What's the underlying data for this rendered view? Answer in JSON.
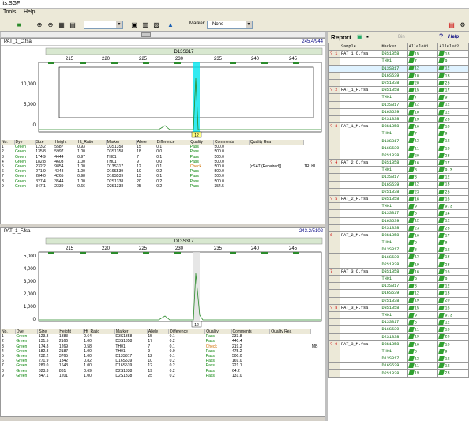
{
  "window": {
    "title": "its.SGF"
  },
  "menu": [
    "Tools",
    "Help"
  ],
  "toolbar": {
    "marker_label": "Marker:",
    "marker_value": "--None--"
  },
  "panel1": {
    "file": "PAT_1_C.fsa",
    "range": "245.4/944",
    "marker": "D13S317",
    "ticks": [
      "215",
      "220",
      "225",
      "230",
      "235",
      "240",
      "245"
    ],
    "yticks": [
      "10,000",
      "5,000",
      "0"
    ],
    "peak_label": "12"
  },
  "panel2": {
    "file": "PAT_1_F.fsa",
    "range": "243.2/5102",
    "marker": "D13S317",
    "ticks": [
      "215",
      "220",
      "225",
      "230",
      "235",
      "240",
      "245"
    ],
    "yticks": [
      "5,000",
      "4,000",
      "3,000",
      "2,000",
      "1,000",
      "0"
    ],
    "peak_label": "12"
  },
  "table_headers": [
    "No.",
    "Dye",
    "Size",
    "Height",
    "Ht_Ratio",
    "Marker",
    "Allele",
    "Difference",
    "Quality",
    "Comments",
    "Quality Rea"
  ],
  "table1": [
    [
      "1",
      "Green",
      "123.2",
      "5587",
      "0.93",
      "D3S1358",
      "15",
      "0.1",
      "Pass",
      "500.0",
      "",
      ""
    ],
    [
      "2",
      "Green",
      "135.8",
      "5997",
      "1.00",
      "D3S1358",
      "18",
      "0.0",
      "Pass",
      "500.0",
      "",
      ""
    ],
    [
      "3",
      "Green",
      "174.9",
      "4444",
      "0.97",
      "TH01",
      "7",
      "0.1",
      "Pass",
      "500.0",
      "",
      ""
    ],
    [
      "4",
      "Green",
      "182.8",
      "4603",
      "1.00",
      "TH01",
      "9",
      "0.0",
      "Pass",
      "500.0",
      "",
      ""
    ],
    [
      "5",
      "Green",
      "232.2",
      "9854",
      "1.00",
      "D13S317",
      "12",
      "0.1",
      "Check",
      "500.0",
      "[cSAT (Repaired)]",
      "1R, HI"
    ],
    [
      "6",
      "Green",
      "271.9",
      "4348",
      "1.00",
      "D16S539",
      "10",
      "0.2",
      "Pass",
      "500.0",
      "",
      ""
    ],
    [
      "7",
      "Green",
      "284.0",
      "4265",
      "0.98",
      "D16S539",
      "13",
      "0.1",
      "Pass",
      "500.0",
      "",
      ""
    ],
    [
      "8",
      "Green",
      "327.4",
      "3544",
      "1.00",
      "D2S1338",
      "20",
      "0.2",
      "Pass",
      "500.0",
      "",
      ""
    ],
    [
      "9",
      "Green",
      "347.1",
      "2339",
      "0.66",
      "D2S1338",
      "25",
      "0.2",
      "Pass",
      "354.5",
      "",
      ""
    ]
  ],
  "table2": [
    [
      "1",
      "Green",
      "123.3",
      "1383",
      "0.64",
      "D3S1358",
      "15",
      "0.1",
      "Pass",
      "233.8",
      "",
      ""
    ],
    [
      "2",
      "Green",
      "131.5",
      "2166",
      "1.00",
      "D3S1358",
      "17",
      "0.2",
      "Pass",
      "440.4",
      "",
      ""
    ],
    [
      "3",
      "Green",
      "174.8",
      "1269",
      "0.58",
      "TH01",
      "7",
      "0.1",
      "Check",
      "219.2",
      "",
      "MB"
    ],
    [
      "4",
      "Green",
      "182.8",
      "2187",
      "1.00",
      "TH01",
      "9",
      "0.0",
      "Pass",
      "475.2",
      "",
      ""
    ],
    [
      "5",
      "Green",
      "232.2",
      "3765",
      "1.00",
      "D13S317",
      "12",
      "0.1",
      "Pass",
      "500.0",
      "",
      ""
    ],
    [
      "6",
      "Green",
      "271.9",
      "1342",
      "0.82",
      "D16S539",
      "10",
      "0.2",
      "Pass",
      "169.0",
      "",
      ""
    ],
    [
      "7",
      "Green",
      "280.0",
      "1643",
      "1.00",
      "D16S539",
      "12",
      "0.2",
      "Pass",
      "221.1",
      "",
      ""
    ],
    [
      "8",
      "Green",
      "323.3",
      "831",
      "0.69",
      "D2S1338",
      "19",
      "0.2",
      "Pass",
      "64.2",
      "",
      ""
    ],
    [
      "9",
      "Green",
      "347.1",
      "1201",
      "1.00",
      "D2S1338",
      "25",
      "0.2",
      "Pass",
      "131.0",
      "",
      ""
    ]
  ],
  "report": {
    "title": "Report",
    "bin_label": "Bin",
    "help_label": "Help",
    "headers": [
      "Sample",
      "Marker",
      "Allele#1",
      "Allele#2"
    ],
    "rows": [
      [
        "? 1",
        "PAT_1_C.fsa",
        "D3S1358",
        "15",
        "18"
      ],
      [
        "",
        "",
        "TH01",
        "7",
        "9"
      ],
      [
        "",
        "",
        "D13S317",
        "12",
        "12"
      ],
      [
        "",
        "",
        "D16S539",
        "10",
        "13"
      ],
      [
        "",
        "",
        "D2S1338",
        "20",
        "25"
      ],
      [
        "? 2",
        "PAT_1_F.fsa",
        "D3S1358",
        "15",
        "17"
      ],
      [
        "",
        "",
        "TH01",
        "7",
        "9"
      ],
      [
        "",
        "",
        "D13S317",
        "12",
        "12"
      ],
      [
        "",
        "",
        "D16S539",
        "10",
        "12"
      ],
      [
        "",
        "",
        "D2S1338",
        "19",
        "25"
      ],
      [
        "? 3",
        "PAT_1_M.fsa",
        "D3S1358",
        "16",
        "18"
      ],
      [
        "",
        "",
        "TH01",
        "7",
        "9"
      ],
      [
        "",
        "",
        "D13S317",
        "12",
        "12"
      ],
      [
        "",
        "",
        "D16S539",
        "11",
        "13"
      ],
      [
        "",
        "",
        "D2S1338",
        "20",
        "23"
      ],
      [
        "? 4",
        "PAT_2_C.fsa",
        "D3S1358",
        "16",
        "17"
      ],
      [
        "",
        "",
        "TH01",
        "8",
        "9.3"
      ],
      [
        "",
        "",
        "D13S317",
        "8",
        "12"
      ],
      [
        "",
        "",
        "D16S539",
        "12",
        "13"
      ],
      [
        "",
        "",
        "D2S1338",
        "23",
        "25"
      ],
      [
        "? 5",
        "PAT_2_F.fsa",
        "D3S1358",
        "16",
        "16"
      ],
      [
        "",
        "",
        "TH01",
        "9",
        "9.3"
      ],
      [
        "",
        "",
        "D13S317",
        "8",
        "14"
      ],
      [
        "",
        "",
        "D16S539",
        "12",
        "12"
      ],
      [
        "",
        "",
        "D2S1338",
        "23",
        "25"
      ],
      [
        "6",
        "PAT_2_M.fsa",
        "D3S1358",
        "16",
        "17"
      ],
      [
        "",
        "",
        "TH01",
        "8",
        "9"
      ],
      [
        "",
        "",
        "D13S317",
        "8",
        "12"
      ],
      [
        "",
        "",
        "D16S539",
        "13",
        "13"
      ],
      [
        "",
        "",
        "D2S1338",
        "19",
        "23"
      ],
      [
        "7",
        "PAT_3_C.fsa",
        "D3S1358",
        "16",
        "16"
      ],
      [
        "",
        "",
        "TH01",
        "9",
        "9"
      ],
      [
        "",
        "",
        "D13S317",
        "8",
        "12"
      ],
      [
        "",
        "",
        "D16S539",
        "12",
        "13"
      ],
      [
        "",
        "",
        "D2S1338",
        "19",
        "20"
      ],
      [
        "? 8",
        "PAT_3_F.fsa",
        "D3S1358",
        "15",
        "16"
      ],
      [
        "",
        "",
        "TH01",
        "9",
        "9.3"
      ],
      [
        "",
        "",
        "D13S317",
        "8",
        "12"
      ],
      [
        "",
        "",
        "D16S539",
        "11",
        "13"
      ],
      [
        "",
        "",
        "D2S1338",
        "19",
        "20"
      ],
      [
        "? 9",
        "PAT_3_M.fsa",
        "D3S1358",
        "16",
        "16"
      ],
      [
        "",
        "",
        "TH01",
        "8",
        "9"
      ],
      [
        "",
        "",
        "D13S317",
        "12",
        "12"
      ],
      [
        "",
        "",
        "D16S539",
        "11",
        "12"
      ],
      [
        "",
        "",
        "D2S1338",
        "19",
        "23"
      ]
    ]
  }
}
